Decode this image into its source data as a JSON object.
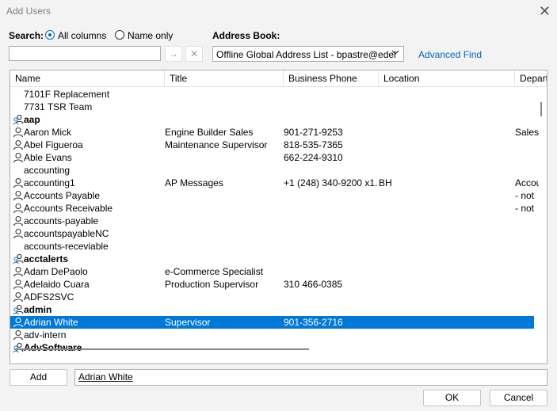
{
  "window": {
    "title": "Add Users",
    "close": "✕"
  },
  "search": {
    "label": "Search:",
    "option_all": "All columns",
    "option_name": "Name only",
    "value": "",
    "go_icon": "→",
    "clear_icon": "✕"
  },
  "address_book": {
    "label": "Address Book:",
    "selected": "Offline Global Address List - bpastre@edel",
    "advanced_find": "Advanced Find"
  },
  "columns": [
    "Name",
    "Title",
    "Business Phone",
    "Location",
    "Depart"
  ],
  "rows": [
    {
      "icon": "none",
      "name": "7101F Replacement",
      "title": "",
      "phone": "",
      "location": "",
      "dept": "",
      "bold": false,
      "selected": false
    },
    {
      "icon": "none",
      "name": "7731 TSR Team",
      "title": "",
      "phone": "",
      "location": "",
      "dept": "",
      "bold": false,
      "selected": false
    },
    {
      "icon": "group",
      "name": "aap",
      "title": "",
      "phone": "",
      "location": "",
      "dept": "",
      "bold": true,
      "selected": false
    },
    {
      "icon": "user",
      "name": "Aaron Mick",
      "title": "Engine Builder Sales",
      "phone": "901-271-9253",
      "location": "",
      "dept": "Sales",
      "bold": false,
      "selected": false
    },
    {
      "icon": "user",
      "name": "Abel Figueroa",
      "title": "Maintenance Supervisor",
      "phone": "818-535-7365",
      "location": "",
      "dept": "",
      "bold": false,
      "selected": false
    },
    {
      "icon": "user",
      "name": "Able Evans",
      "title": "",
      "phone": "662-224-9310",
      "location": "",
      "dept": "",
      "bold": false,
      "selected": false
    },
    {
      "icon": "none",
      "name": "accounting",
      "title": "",
      "phone": "",
      "location": "",
      "dept": "",
      "bold": false,
      "selected": false
    },
    {
      "icon": "user",
      "name": "accounting1",
      "title": "AP Messages",
      "phone": "+1 (248) 340-9200 x1...",
      "location": "BH",
      "dept": "Accou",
      "bold": false,
      "selected": false
    },
    {
      "icon": "user",
      "name": "Accounts Payable",
      "title": "",
      "phone": "",
      "location": "",
      "dept": "- not",
      "bold": false,
      "selected": false
    },
    {
      "icon": "user",
      "name": "Accounts Receivable",
      "title": "",
      "phone": "",
      "location": "",
      "dept": "- not",
      "bold": false,
      "selected": false
    },
    {
      "icon": "user",
      "name": "accounts-payable",
      "title": "",
      "phone": "",
      "location": "",
      "dept": "",
      "bold": false,
      "selected": false
    },
    {
      "icon": "user",
      "name": "accountspayableNC",
      "title": "",
      "phone": "",
      "location": "",
      "dept": "",
      "bold": false,
      "selected": false
    },
    {
      "icon": "none",
      "name": "accounts-receviable",
      "title": "",
      "phone": "",
      "location": "",
      "dept": "",
      "bold": false,
      "selected": false
    },
    {
      "icon": "group",
      "name": "acctalerts",
      "title": "",
      "phone": "",
      "location": "",
      "dept": "",
      "bold": true,
      "selected": false
    },
    {
      "icon": "user",
      "name": "Adam DePaolo",
      "title": "e-Commerce Specialist",
      "phone": "",
      "location": "",
      "dept": "",
      "bold": false,
      "selected": false
    },
    {
      "icon": "user",
      "name": "Adelaido Cuara",
      "title": "Production Supervisor",
      "phone": "310 466-0385",
      "location": "",
      "dept": "",
      "bold": false,
      "selected": false
    },
    {
      "icon": "user",
      "name": "ADFS2SVC",
      "title": "",
      "phone": "",
      "location": "",
      "dept": "",
      "bold": false,
      "selected": false
    },
    {
      "icon": "group",
      "name": "admin",
      "title": "",
      "phone": "",
      "location": "",
      "dept": "",
      "bold": true,
      "selected": false
    },
    {
      "icon": "user",
      "name": "Adrian White",
      "title": "Supervisor",
      "phone": "901-356-2716",
      "location": "",
      "dept": "",
      "bold": false,
      "selected": true
    },
    {
      "icon": "user",
      "name": "adv-intern",
      "title": "",
      "phone": "",
      "location": "",
      "dept": "",
      "bold": false,
      "selected": false
    },
    {
      "icon": "group",
      "name": "AdvSoftware",
      "title": "",
      "phone": "",
      "location": "",
      "dept": "",
      "bold": true,
      "selected": false
    }
  ],
  "footer": {
    "add_label": "Add",
    "selected_name": "Adrian White",
    "ok_label": "OK",
    "cancel_label": "Cancel"
  },
  "colors": {
    "accent": "#0067c0",
    "selection": "#0078d7",
    "background": "#f3f3f3"
  }
}
